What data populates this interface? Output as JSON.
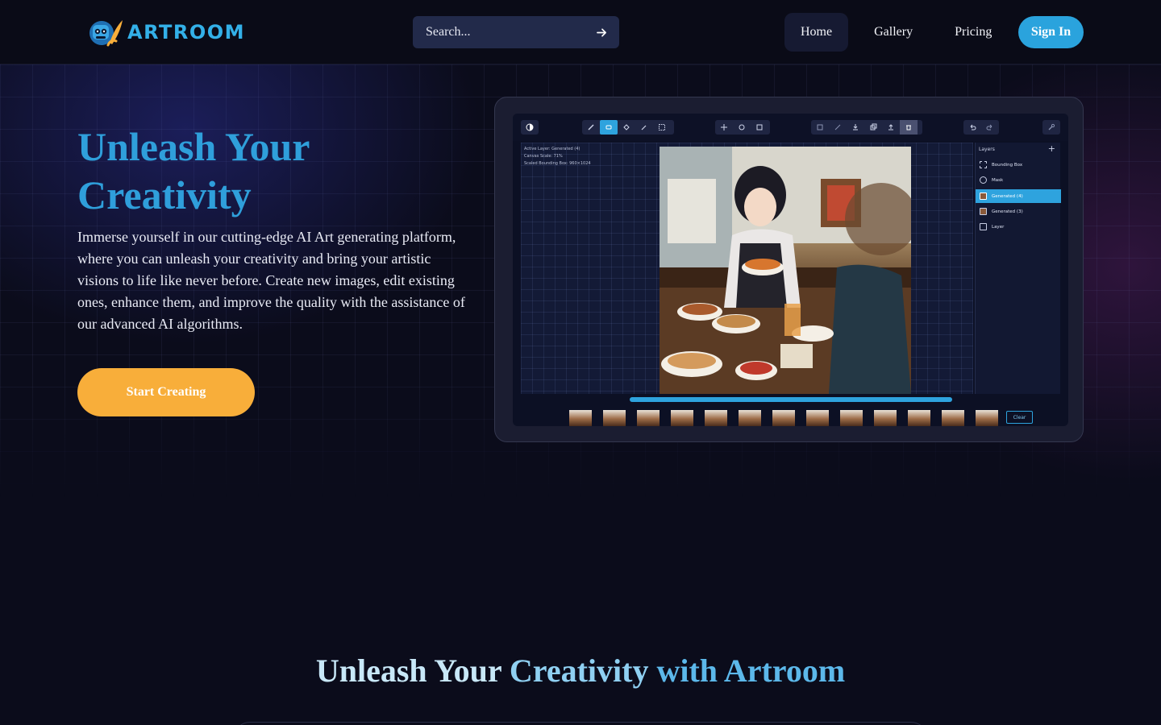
{
  "nav": {
    "logo_text": "ARTROOM",
    "search_placeholder": "Search...",
    "links": [
      "Home",
      "Gallery",
      "Pricing"
    ],
    "active_link": "Home",
    "sign_in": "Sign In"
  },
  "hero": {
    "title": "Unleash Your Creativity",
    "description": "Immerse yourself in our cutting-edge AI Art generating platform, where you can unleash your creativity and bring your artistic visions to life like never before. Create new images, edit existing ones, enhance them, and improve the quality with the assistance of our advanced AI algorithms.",
    "cta": "Start Creating"
  },
  "preview": {
    "canvas_info": [
      "Active Layer: Generated (4)",
      "Canvas Scale: 71%",
      "Scaled Bounding Box: 960×1024"
    ],
    "layers_header": "Layers",
    "layers": [
      "Bounding Box",
      "Mask",
      "Generated (4)",
      "Generated (3)",
      "Layer"
    ],
    "selected_layer": "Generated (4)",
    "progress": 1.0,
    "clear": "Clear"
  },
  "section2": {
    "title_parts": [
      "Unleash Your ",
      "Creativity ",
      "with Artroom"
    ]
  },
  "colors": {
    "accent": "#2aa3dd",
    "cta": "#f8ae3a",
    "background": "#0b0c1b"
  }
}
